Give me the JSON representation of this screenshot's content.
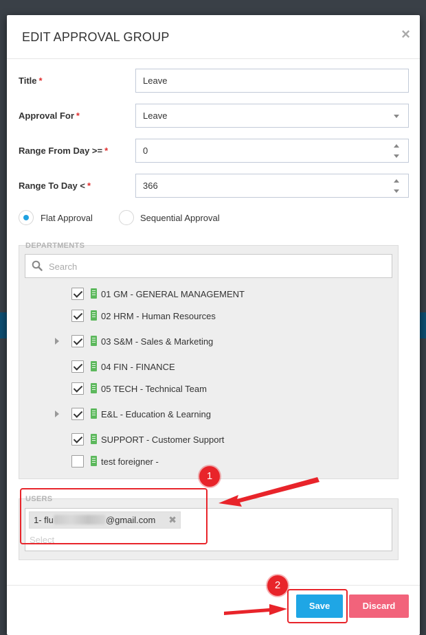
{
  "modal": {
    "title": "EDIT APPROVAL GROUP",
    "close_glyph": "×"
  },
  "form": {
    "required_mark": "*",
    "title": {
      "label": "Title",
      "value": "Leave"
    },
    "approval_for": {
      "label": "Approval For",
      "value": "Leave"
    },
    "range_from": {
      "label": "Range From Day >=",
      "value": "0"
    },
    "range_to": {
      "label": "Range To Day <",
      "value": "366"
    },
    "approval_type": {
      "options": [
        {
          "label": "Flat Approval",
          "checked": true
        },
        {
          "label": "Sequential Approval",
          "checked": false
        }
      ]
    }
  },
  "departments": {
    "caption": "DEPARTMENTS",
    "search_placeholder": "Search",
    "items": [
      {
        "label": "01 GM - GENERAL MANAGEMENT",
        "checked": true,
        "expandable": false
      },
      {
        "label": "02 HRM - Human Resources",
        "checked": true,
        "expandable": false
      },
      {
        "label": "03 S&M - Sales & Marketing",
        "checked": true,
        "expandable": true
      },
      {
        "label": "04 FIN - FINANCE",
        "checked": true,
        "expandable": false
      },
      {
        "label": "05 TECH - Technical Team",
        "checked": true,
        "expandable": false
      },
      {
        "label": "E&L - Education & Learning",
        "checked": true,
        "expandable": true
      },
      {
        "label": "SUPPORT - Customer Support",
        "checked": true,
        "expandable": false
      },
      {
        "label": "test foreigner -",
        "checked": false,
        "expandable": false
      }
    ]
  },
  "users": {
    "caption": "USERS",
    "tag": {
      "prefix": "1- flu",
      "suffix": "@gmail.com",
      "remove_glyph": "✖"
    },
    "placeholder": "Select"
  },
  "footer": {
    "save_label": "Save",
    "discard_label": "Discard"
  },
  "annotations": {
    "step1": "1",
    "step2": "2",
    "color": "#e8242a"
  },
  "colors": {
    "primary": "#1fa6e5",
    "danger": "#f2637b",
    "dept_icon": "#5cb85c",
    "required": "#e02f2f"
  }
}
